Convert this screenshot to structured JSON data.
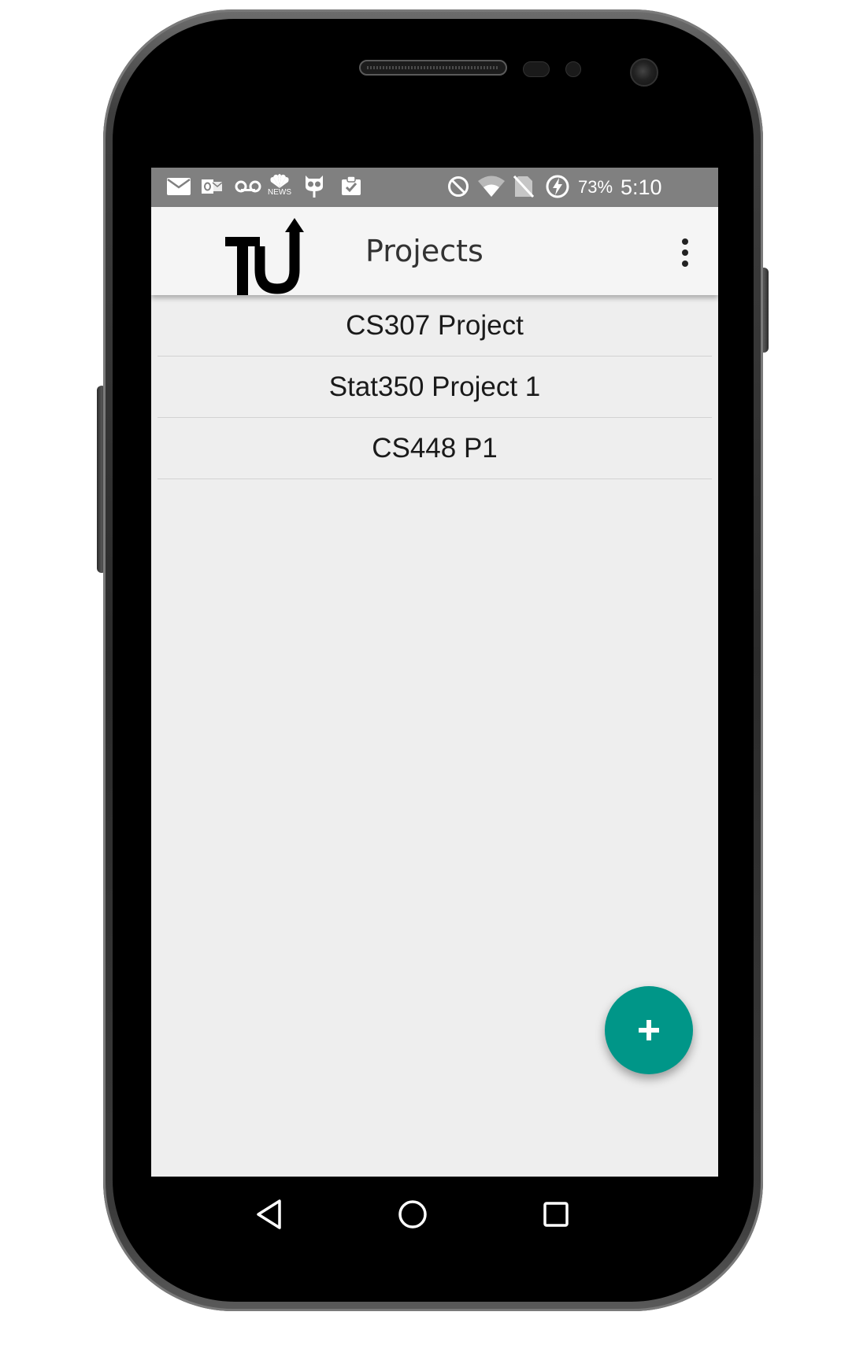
{
  "status_bar": {
    "battery_percent": "73%",
    "time": "5:10",
    "notification_icons": [
      "mail-icon",
      "outlook-icon",
      "voicemail-icon",
      "nbc-news-icon",
      "cyanogen-icon",
      "clipboard-check-icon"
    ],
    "system_icons": [
      "do-not-disturb-icon",
      "wifi-icon",
      "no-sim-icon",
      "battery-charging-icon"
    ],
    "nbc_badge_text": "NEWS"
  },
  "app_bar": {
    "logo_text": "TU",
    "title": "Projects",
    "overflow_icon": "more-vert-icon"
  },
  "projects": [
    {
      "name": "CS307 Project"
    },
    {
      "name": "Stat350 Project 1"
    },
    {
      "name": "CS448 P1"
    }
  ],
  "fab": {
    "icon": "add-icon"
  },
  "nav_bar": {
    "buttons": [
      "back-icon",
      "home-icon",
      "recents-icon"
    ]
  },
  "colors": {
    "status_bar": "#808080",
    "app_bar": "#f5f5f5",
    "content_bg": "#eeeeee",
    "fab": "#009688",
    "title_text": "#333333"
  }
}
